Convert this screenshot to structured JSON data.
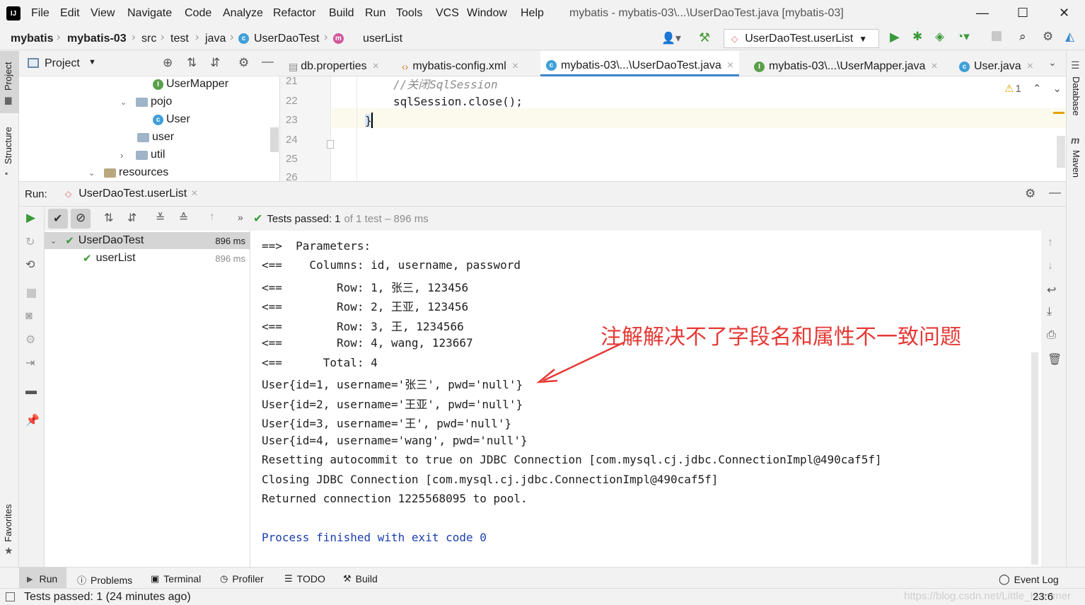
{
  "menu": {
    "items": [
      "File",
      "Edit",
      "View",
      "Navigate",
      "Code",
      "Analyze",
      "Refactor",
      "Build",
      "Run",
      "Tools",
      "VCS",
      "Window",
      "Help"
    ],
    "window_title": "mybatis - mybatis-03\\...\\UserDaoTest.java [mybatis-03]"
  },
  "breadcrumb": {
    "items": [
      "mybatis",
      "mybatis-03",
      "src",
      "test",
      "java",
      "UserDaoTest",
      "userList"
    ]
  },
  "toolbar": {
    "run_config": "UserDaoTest.userList"
  },
  "side_tabs": {
    "project": "Project",
    "structure": "Structure",
    "favorites": "Favorites",
    "database": "Database",
    "maven": "Maven"
  },
  "project_panel": {
    "title": "Project",
    "tree": [
      {
        "label": "UserMapper",
        "type": "interface"
      },
      {
        "label": "pojo",
        "type": "folder"
      },
      {
        "label": "User",
        "type": "class"
      },
      {
        "label": "user",
        "type": "folder"
      },
      {
        "label": "util",
        "type": "folder"
      },
      {
        "label": "resources",
        "type": "folder"
      }
    ]
  },
  "editor": {
    "tabs": [
      {
        "label": "db.properties"
      },
      {
        "label": "mybatis-config.xml"
      },
      {
        "label": "mybatis-03\\...\\UserDaoTest.java"
      },
      {
        "label": "mybatis-03\\...\\UserMapper.java"
      },
      {
        "label": "User.java"
      }
    ],
    "line_numbers": [
      "21",
      "22",
      "23",
      "24",
      "25",
      "26"
    ],
    "lines": [
      "//关闭SqlSession",
      "sqlSession.close();",
      "}"
    ],
    "warning_count": "1"
  },
  "run_panel": {
    "label": "Run:",
    "tab": "UserDaoTest.userList",
    "status_prefix": "Tests passed:",
    "status_count": "1",
    "status_suffix": "of 1 test – 896 ms",
    "tests": [
      {
        "name": "UserDaoTest",
        "time": "896 ms"
      },
      {
        "name": "userList",
        "time": "896 ms"
      }
    ],
    "console": [
      "==>  Parameters: ",
      "<==    Columns: id, username, password",
      "<==        Row: 1, 张三, 123456",
      "<==        Row: 2, 王亚, 123456",
      "<==        Row: 3, 王, 1234566",
      "<==        Row: 4, wang, 123667",
      "<==      Total: 4",
      "User{id=1, username='张三', pwd='null'}",
      "User{id=2, username='王亚', pwd='null'}",
      "User{id=3, username='王', pwd='null'}",
      "User{id=4, username='wang', pwd='null'}",
      "Resetting autocommit to true on JDBC Connection [com.mysql.cj.jdbc.ConnectionImpl@490caf5f]",
      "Closing JDBC Connection [com.mysql.cj.jdbc.ConnectionImpl@490caf5f]",
      "Returned connection 1225568095 to pool.",
      "",
      "Process finished with exit code 0"
    ],
    "annotation": "注解解决不了字段名和属性不一致问题",
    "annotation_color": "#e53935"
  },
  "bottom_tabs": [
    "Run",
    "Problems",
    "Terminal",
    "Profiler",
    "TODO",
    "Build"
  ],
  "event_log": "Event Log",
  "status": {
    "text": "Tests passed: 1 (24 minutes ago)",
    "position": "23:6",
    "watermark": "https://blog.csdn.net/Little_Hammer"
  }
}
